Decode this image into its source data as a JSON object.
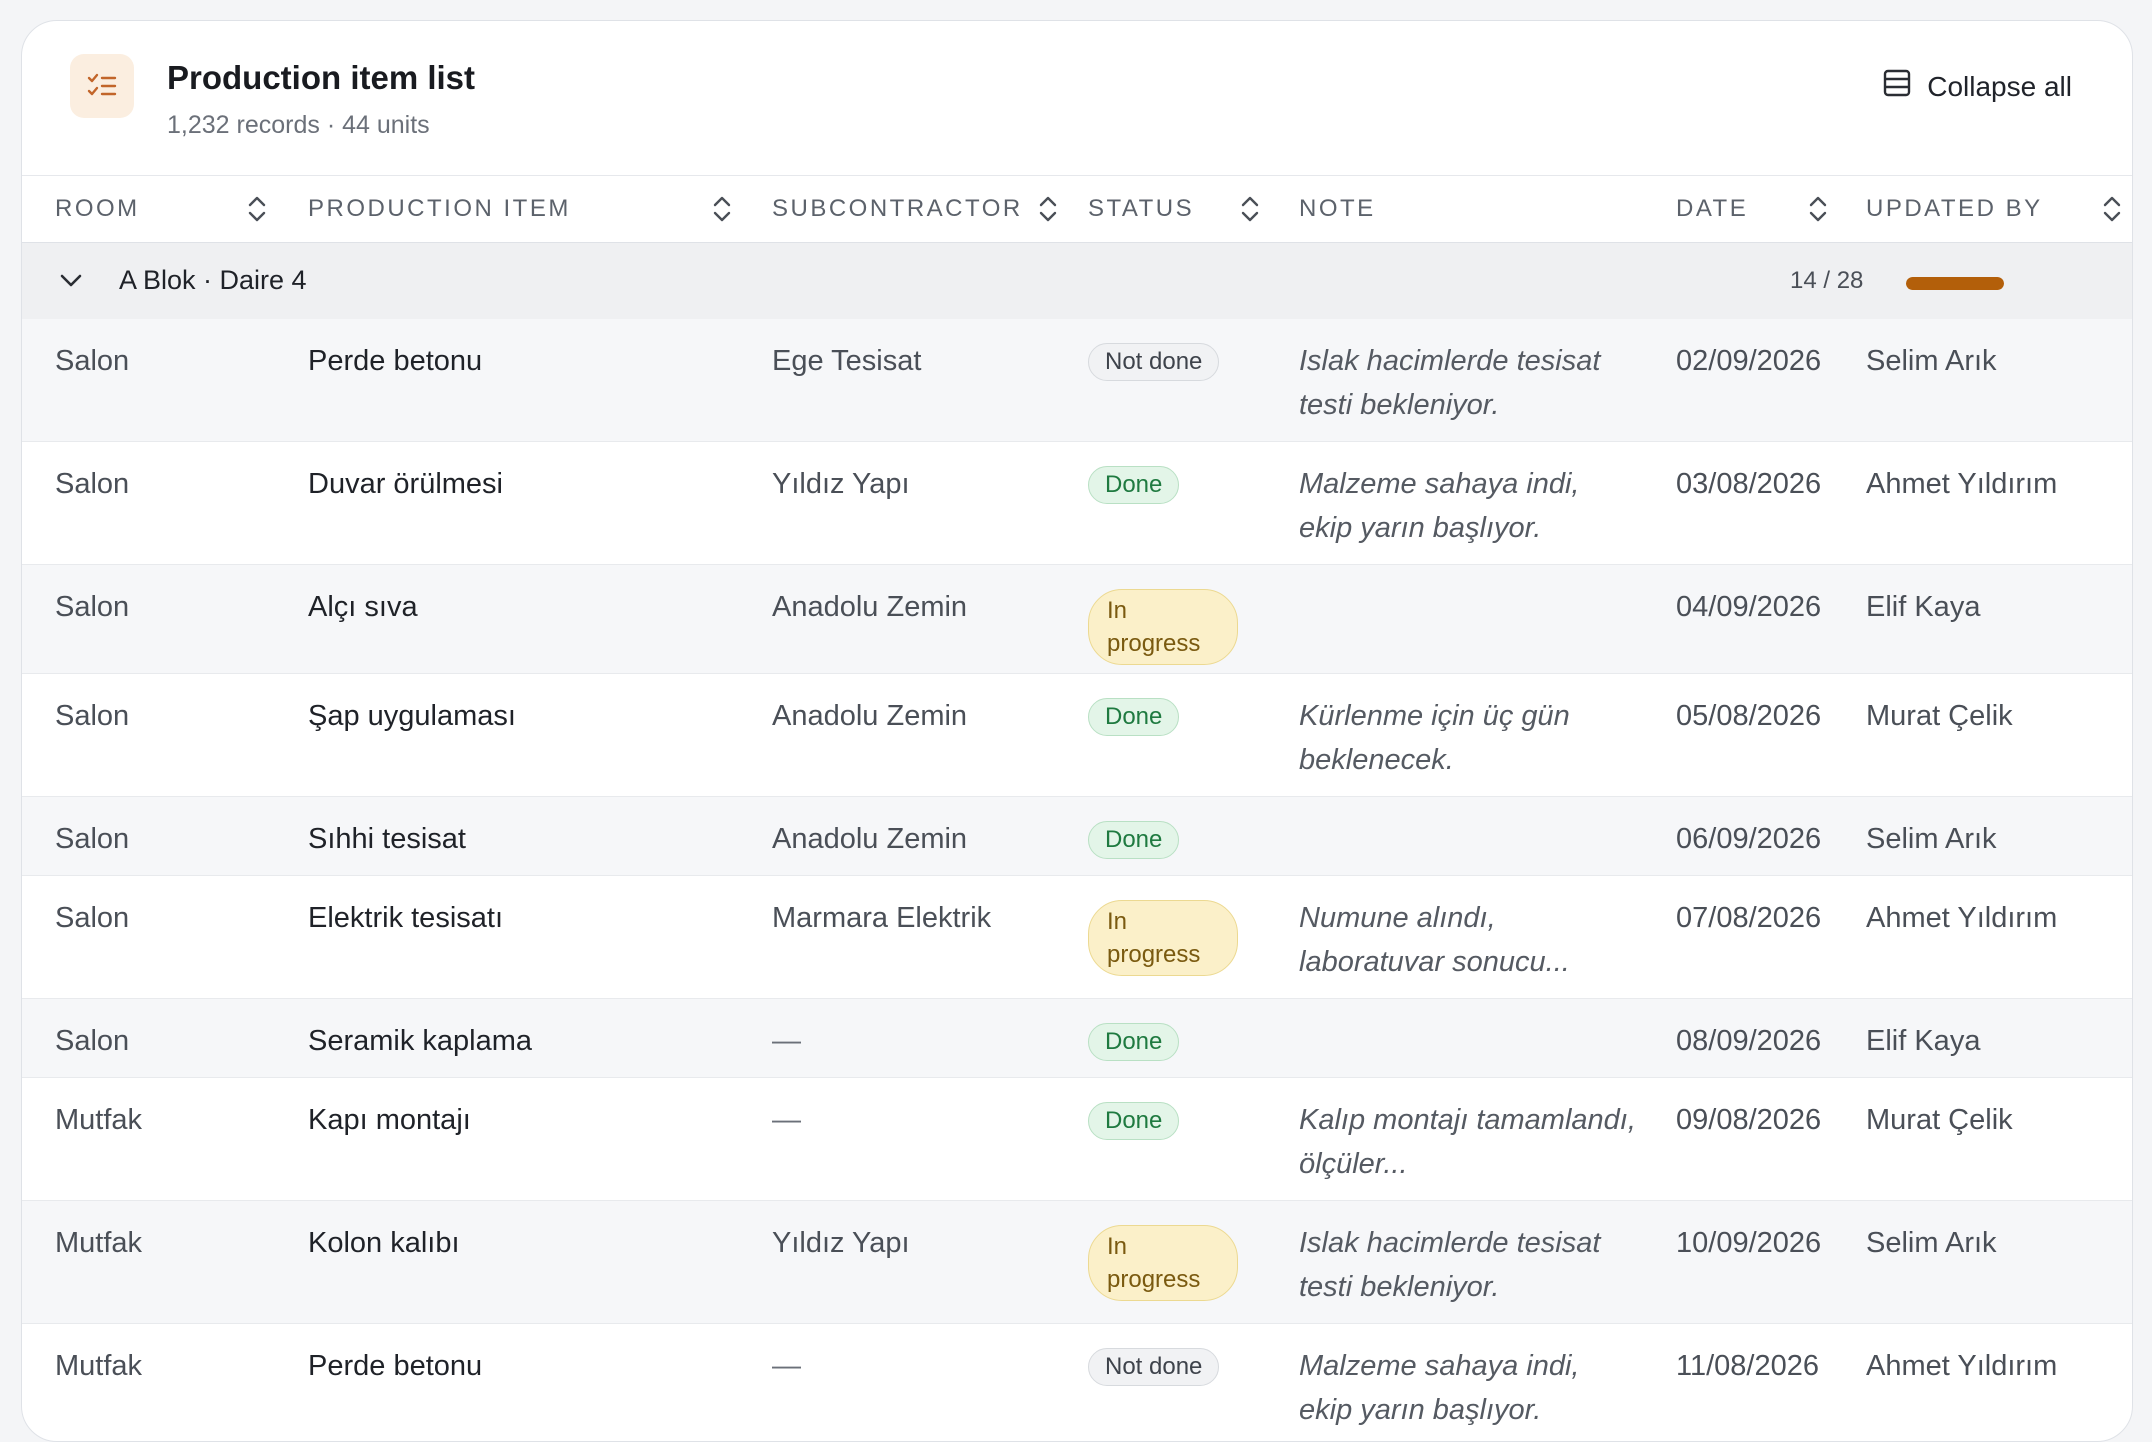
{
  "header": {
    "title": "Production item list",
    "subtitle": "1,232 records · 44 units",
    "collapse_label": "Collapse all"
  },
  "columns": {
    "room": "ROOM",
    "item": "PRODUCTION ITEM",
    "subcontractor": "SUBCONTRACTOR",
    "status": "STATUS",
    "note": "NOTE",
    "date": "DATE",
    "updated_by": "UPDATED BY"
  },
  "group": {
    "label": "A Blok · Daire 4",
    "count": "14 / 28",
    "progress": 1.0
  },
  "rows": [
    {
      "room": "Salon",
      "item": "Perde betonu",
      "subcontractor": "Ege Tesisat",
      "status": "Not done",
      "status_type": "notdone",
      "note": "Islak hacimlerde tesisat testi bekleniyor.",
      "date": "02/09/2026",
      "updated_by": "Selim Arık"
    },
    {
      "room": "Salon",
      "item": "Duvar örülmesi",
      "subcontractor": "Yıldız Yapı",
      "status": "Done",
      "status_type": "done",
      "note": "Malzeme sahaya indi, ekip yarın başlıyor.",
      "date": "03/08/2026",
      "updated_by": "Ahmet Yıldırım"
    },
    {
      "room": "Salon",
      "item": "Alçı sıva",
      "subcontractor": "Anadolu Zemin",
      "status": "In progress",
      "status_type": "inprog",
      "note": "",
      "date": "04/09/2026",
      "updated_by": "Elif Kaya"
    },
    {
      "room": "Salon",
      "item": "Şap uygulaması",
      "subcontractor": "Anadolu Zemin",
      "status": "Done",
      "status_type": "done",
      "note": "Kürlenme için üç gün beklenecek.",
      "date": "05/08/2026",
      "updated_by": "Murat Çelik"
    },
    {
      "room": "Salon",
      "item": "Sıhhi tesisat",
      "subcontractor": "Anadolu Zemin",
      "status": "Done",
      "status_type": "done",
      "note": "",
      "date": "06/09/2026",
      "updated_by": "Selim Arık"
    },
    {
      "room": "Salon",
      "item": "Elektrik tesisatı",
      "subcontractor": "Marmara Elektrik",
      "status": "In progress",
      "status_type": "inprog",
      "note": "Numune alındı, laboratuvar sonucu...",
      "date": "07/08/2026",
      "updated_by": "Ahmet Yıldırım"
    },
    {
      "room": "Salon",
      "item": "Seramik kaplama",
      "subcontractor": "—",
      "status": "Done",
      "status_type": "done",
      "note": "",
      "date": "08/09/2026",
      "updated_by": "Elif Kaya"
    },
    {
      "room": "Mutfak",
      "item": "Kapı montajı",
      "subcontractor": "—",
      "status": "Done",
      "status_type": "done",
      "note": "Kalıp montajı tamamlandı, ölçüler...",
      "date": "09/08/2026",
      "updated_by": "Murat Çelik"
    },
    {
      "room": "Mutfak",
      "item": "Kolon kalıbı",
      "subcontractor": "Yıldız Yapı",
      "status": "In progress",
      "status_type": "inprog",
      "note": "Islak hacimlerde tesisat testi bekleniyor.",
      "date": "10/09/2026",
      "updated_by": "Selim Arık"
    },
    {
      "room": "Mutfak",
      "item": "Perde betonu",
      "subcontractor": "—",
      "status": "Not done",
      "status_type": "notdone",
      "note": "Malzeme sahaya indi, ekip yarın başlıyor.",
      "date": "11/08/2026",
      "updated_by": "Ahmet Yıldırım"
    }
  ]
}
